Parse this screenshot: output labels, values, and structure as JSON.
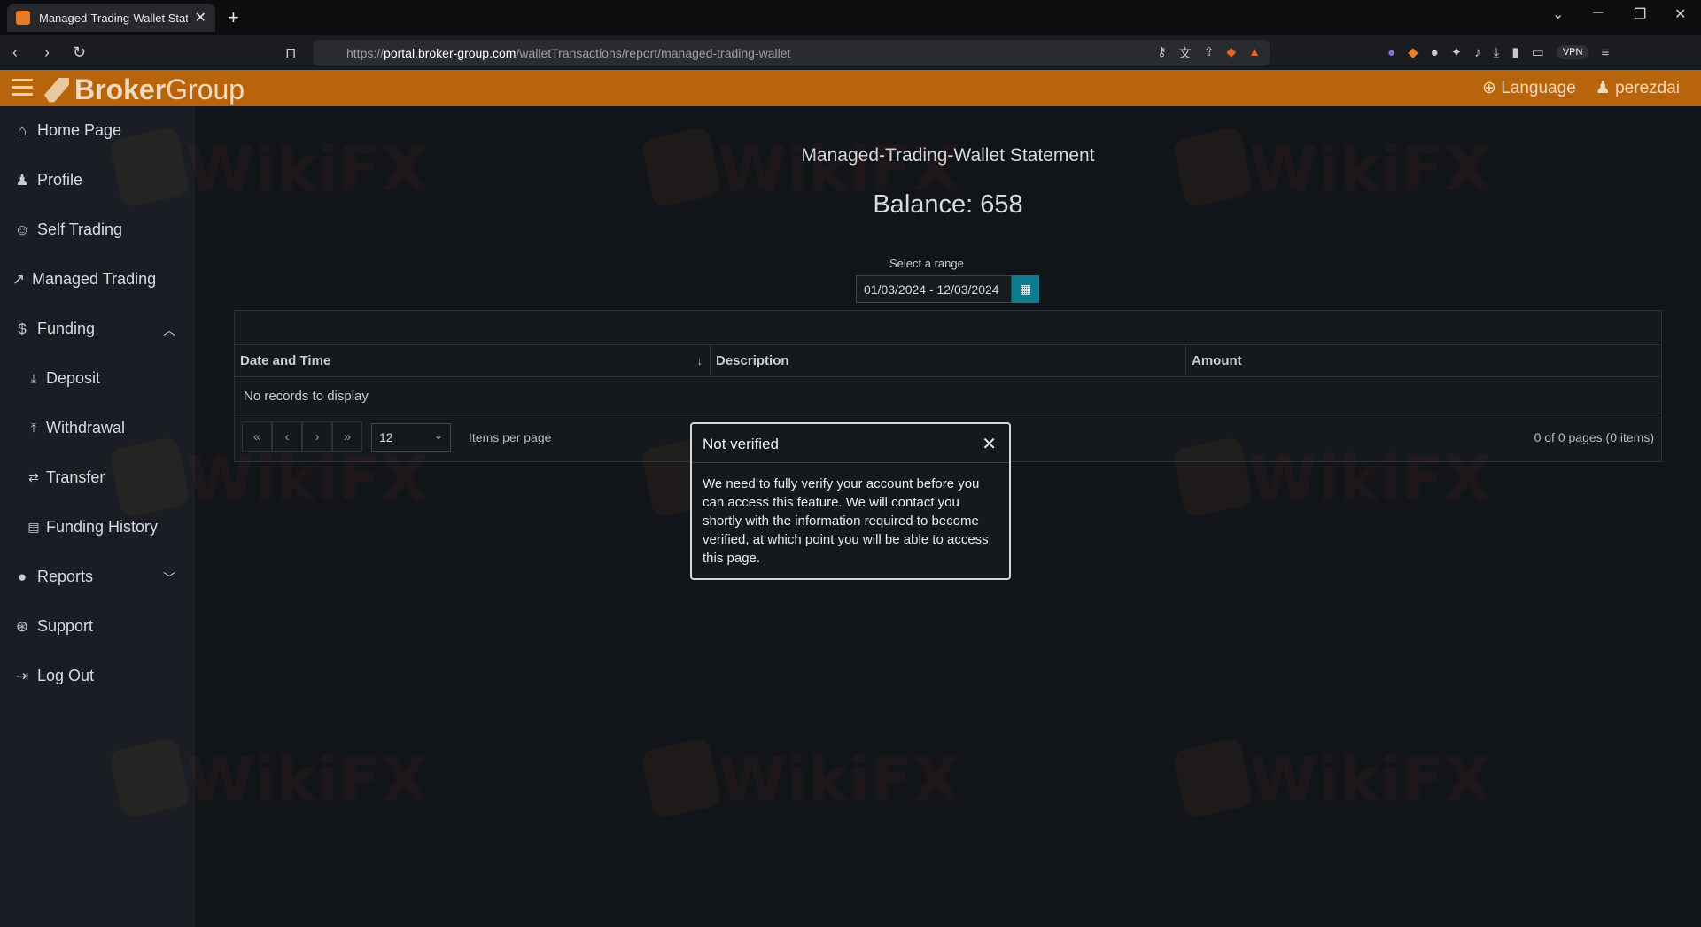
{
  "browser": {
    "tab_title": "Managed-Trading-Wallet Statem",
    "url_prefix": "https://",
    "url_host": "portal.broker-group.com",
    "url_path": "/walletTransactions/report/managed-trading-wallet",
    "vpn_label": "VPN"
  },
  "header": {
    "logo_bold": "Broker",
    "logo_light": "Group",
    "language": "Language",
    "username": "perezdai"
  },
  "sidebar": {
    "items": [
      {
        "label": "Home Page",
        "icon": "home-icon"
      },
      {
        "label": "Profile",
        "icon": "user-icon"
      },
      {
        "label": "Self Trading",
        "icon": "self-trading-icon"
      },
      {
        "label": "Managed Trading",
        "icon": "chart-line-icon"
      },
      {
        "label": "Funding",
        "icon": "funding-icon"
      },
      {
        "label": "Deposit",
        "icon": "download-icon"
      },
      {
        "label": "Withdrawal",
        "icon": "upload-icon"
      },
      {
        "label": "Transfer",
        "icon": "transfer-icon"
      },
      {
        "label": "Funding History",
        "icon": "file-icon"
      },
      {
        "label": "Reports",
        "icon": "reports-icon"
      },
      {
        "label": "Support",
        "icon": "support-icon"
      },
      {
        "label": "Log Out",
        "icon": "logout-icon"
      }
    ]
  },
  "main": {
    "title": "Managed-Trading-Wallet Statement",
    "balance": "Balance: 658",
    "range_label": "Select a range",
    "range_value": "01/03/2024 - 12/03/2024"
  },
  "grid": {
    "columns": [
      "Date and Time",
      "Description",
      "Amount"
    ],
    "empty_text": "No records to display",
    "page_size": "12",
    "items_per_page": "Items per page",
    "page_info": "0 of 0 pages (0 items)"
  },
  "modal": {
    "title": "Not verified",
    "body": "We need to fully verify your account before you can access this feature. We will contact you shortly with the information required to become verified, at which point you will be able to access this page."
  },
  "watermark": "WikiFX",
  "colors": {
    "header_bg": "#b8640c",
    "sidebar_bg": "#1a1e24",
    "content_bg": "#111419",
    "calendar_button": "#0f7b8e"
  }
}
